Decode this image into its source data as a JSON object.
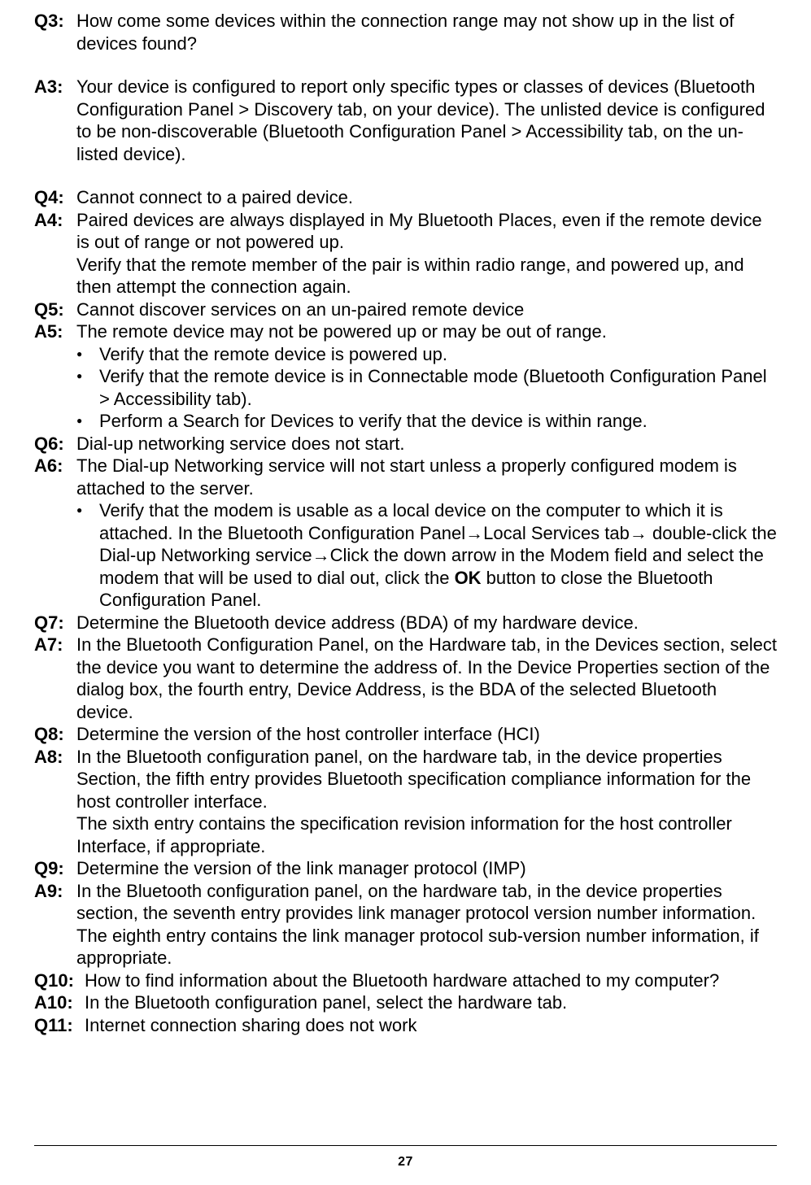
{
  "page_number": "27",
  "q3": {
    "label": "Q3:",
    "text": "How come some devices within the connection range may not show up in the list of devices found?"
  },
  "a3": {
    "label": "A3:",
    "text": "Your device is configured to report only specific types or classes of devices (Bluetooth Configuration Panel > Discovery tab, on your device). The unlisted device is configured to be non-discoverable (Bluetooth Configuration Panel > Accessibility tab, on the un-listed device)."
  },
  "q4": {
    "label": "Q4:",
    "text": "Cannot connect to a paired device."
  },
  "a4": {
    "label": "A4:",
    "p1": "Paired devices are always displayed in My Bluetooth Places, even if the remote device is out of range or not powered up.",
    "p2": "Verify that the remote member of the pair is within radio range, and powered up, and then attempt the connection again."
  },
  "q5": {
    "label": "Q5:",
    "text": "Cannot discover services on an un-paired remote device"
  },
  "a5": {
    "label": "A5:",
    "intro": "The remote device may not be powered up or may be out of range.",
    "bullets": [
      "Verify that the remote device is powered up.",
      "Verify that the remote device is in Connectable mode (Bluetooth Configuration Panel > Accessibility tab).",
      "Perform a Search for Devices to verify that the device is within range."
    ]
  },
  "q6": {
    "label": "Q6:",
    "text": "Dial-up networking service does not start."
  },
  "a6": {
    "label": "A6:",
    "intro": "The Dial-up Networking service will not start unless a properly configured modem is attached to the server.",
    "bullet_pre": "Verify that the modem is usable as a local device on the computer to which it is attached. In the Bluetooth Configuration Panel",
    "arrow1": "→",
    "bullet_mid1": "Local Services tab",
    "arrow2": "→",
    "bullet_mid2": " double-click the Dial-up Networking service",
    "arrow3": "→",
    "bullet_post1": "Click the down arrow in the Modem field and select the modem that will be used to dial out, click the ",
    "ok": "OK",
    "bullet_post2": " button to close the Bluetooth Configuration Panel."
  },
  "q7": {
    "label": "Q7:",
    "text": "Determine the Bluetooth device address (BDA) of my hardware device."
  },
  "a7": {
    "label": "A7:",
    "text": "In the Bluetooth Configuration Panel, on the Hardware tab, in the Devices section, select the device you want to determine the address of. In the Device Properties section of the dialog box, the fourth entry, Device Address, is the BDA of the selected Bluetooth device."
  },
  "q8": {
    "label": "Q8:",
    "text": "Determine the version of the host controller interface (HCI)"
  },
  "a8": {
    "label": "A8:",
    "p1": "In the Bluetooth configuration panel, on the hardware tab, in the device properties Section, the fifth entry provides Bluetooth specification compliance information for the host controller interface.",
    "p2": "The sixth entry contains the specification revision information for the host controller Interface, if appropriate."
  },
  "q9": {
    "label": "Q9:",
    "text": "Determine the version of the link manager protocol (IMP)"
  },
  "a9": {
    "label": "A9:",
    "p1": "In the Bluetooth configuration panel, on the hardware tab, in the device properties section, the seventh entry provides link manager protocol version number information.",
    "p2": "The eighth entry contains the link manager protocol sub-version number information, if appropriate."
  },
  "q10": {
    "label": "Q10:",
    "text": "How to find information about the Bluetooth hardware attached to my computer?"
  },
  "a10": {
    "label": "A10:",
    "text": "In the Bluetooth configuration panel, select the hardware tab."
  },
  "q11": {
    "label": "Q11:",
    "text": "Internet connection sharing does not work"
  }
}
